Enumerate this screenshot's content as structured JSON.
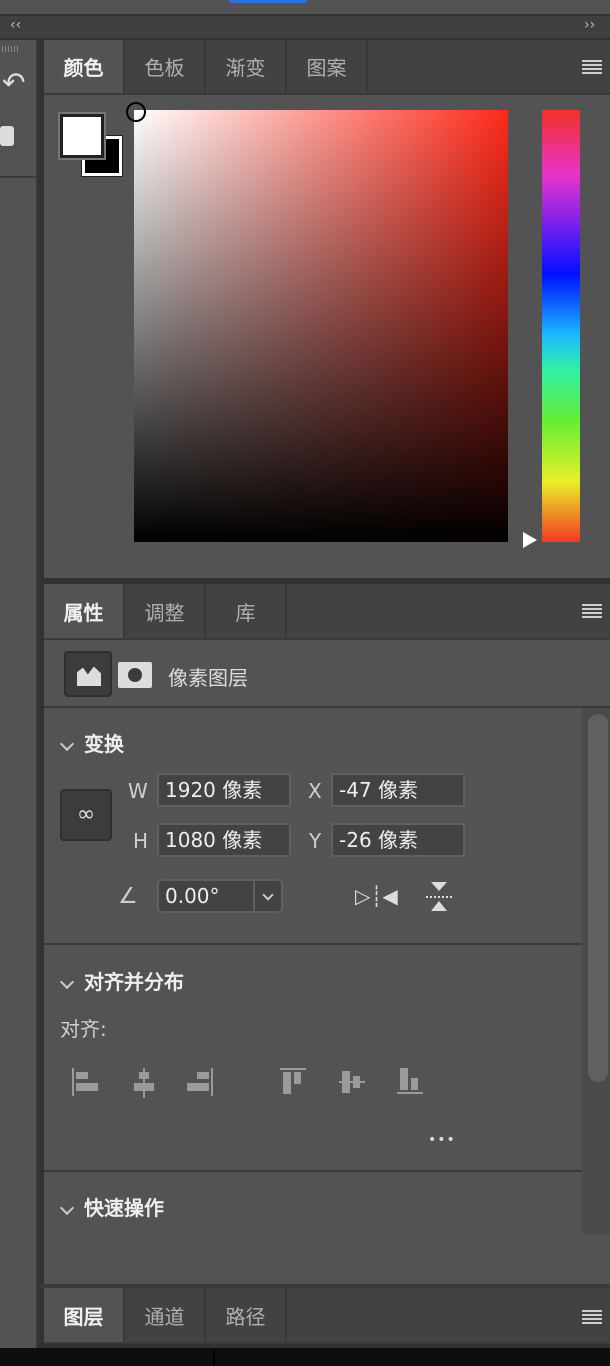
{
  "topbar": {
    "collapse_left": "‹‹",
    "collapse_right": "››"
  },
  "color_panel": {
    "tabs": [
      "颜色",
      "色板",
      "渐变",
      "图案"
    ],
    "active": 0,
    "foreground": "#ffffff",
    "background": "#000000",
    "hue": "#ff2a1a"
  },
  "properties_panel": {
    "tabs": [
      "属性",
      "调整",
      "库"
    ],
    "active": 0,
    "layer_type": "像素图层",
    "transform": {
      "title": "变换",
      "w_label": "W",
      "w": "1920 像素",
      "h_label": "H",
      "h": "1080 像素",
      "x_label": "X",
      "x": "-47 像素",
      "y_label": "Y",
      "y": "-26 像素",
      "angle": "0.00°"
    },
    "align": {
      "title": "对齐并分布",
      "sub": "对齐:",
      "more": "•••"
    },
    "quick": {
      "title": "快速操作"
    }
  },
  "layers_panel": {
    "tabs": [
      "图层",
      "通道",
      "路径"
    ],
    "active": 0
  }
}
